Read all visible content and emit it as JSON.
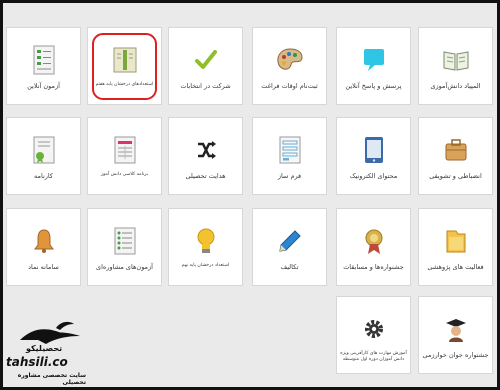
{
  "tiles": [
    {
      "label": "آزمون آنلاین",
      "icon": "document-list-icon"
    },
    {
      "label": "استعدادهای درخشان پایه هفتم",
      "icon": "book-icon"
    },
    {
      "label": "شرکت در انتخابات",
      "icon": "checkmark-icon"
    },
    {
      "label": "ثبت‌نام اوقات فراغت",
      "icon": "palette-icon"
    },
    {
      "label": "پرسش و پاسخ آنلاین",
      "icon": "chat-bubble-icon"
    },
    {
      "label": "المپیاد دانش‌آموزی",
      "icon": "open-book-icon"
    },
    {
      "label": "کارنامه",
      "icon": "certificate-icon"
    },
    {
      "label": "برنامه کلاسی دانش آموز",
      "icon": "schedule-icon"
    },
    {
      "label": "هدایت تحصیلی",
      "icon": "shuffle-icon"
    },
    {
      "label": "فرم ساز",
      "icon": "form-icon"
    },
    {
      "label": "محتوای الکترونیک",
      "icon": "tablet-icon"
    },
    {
      "label": "انضباطی و تشویقی",
      "icon": "briefcase-icon"
    },
    {
      "label": "سامانه نماد",
      "icon": "bell-icon"
    },
    {
      "label": "آزمون‌های مشاوره‌ای",
      "icon": "test-sheet-icon"
    },
    {
      "label": "استعداد درخشان پایه نهم",
      "icon": "lightbulb-icon"
    },
    {
      "label": "تکالیف",
      "icon": "pencil-icon"
    },
    {
      "label": "جشنواره‌ها و مسابقات",
      "icon": "medal-icon"
    },
    {
      "label": "فعالیت های پژوهشی",
      "icon": "folder-icon"
    },
    {
      "label": "آموزش مهارت های کارآفرینی ویژه دانش آموزان دوره اول متوسطه",
      "icon": "gear-icon"
    },
    {
      "label": "جشنواره جوان خوارزمی",
      "icon": "graduate-icon"
    }
  ],
  "logo": {
    "name_fa": "تحصیلیکو",
    "name_en": "tahsili.co",
    "subtitle": "سایت تخصصی مشاوره تحصیلی"
  }
}
